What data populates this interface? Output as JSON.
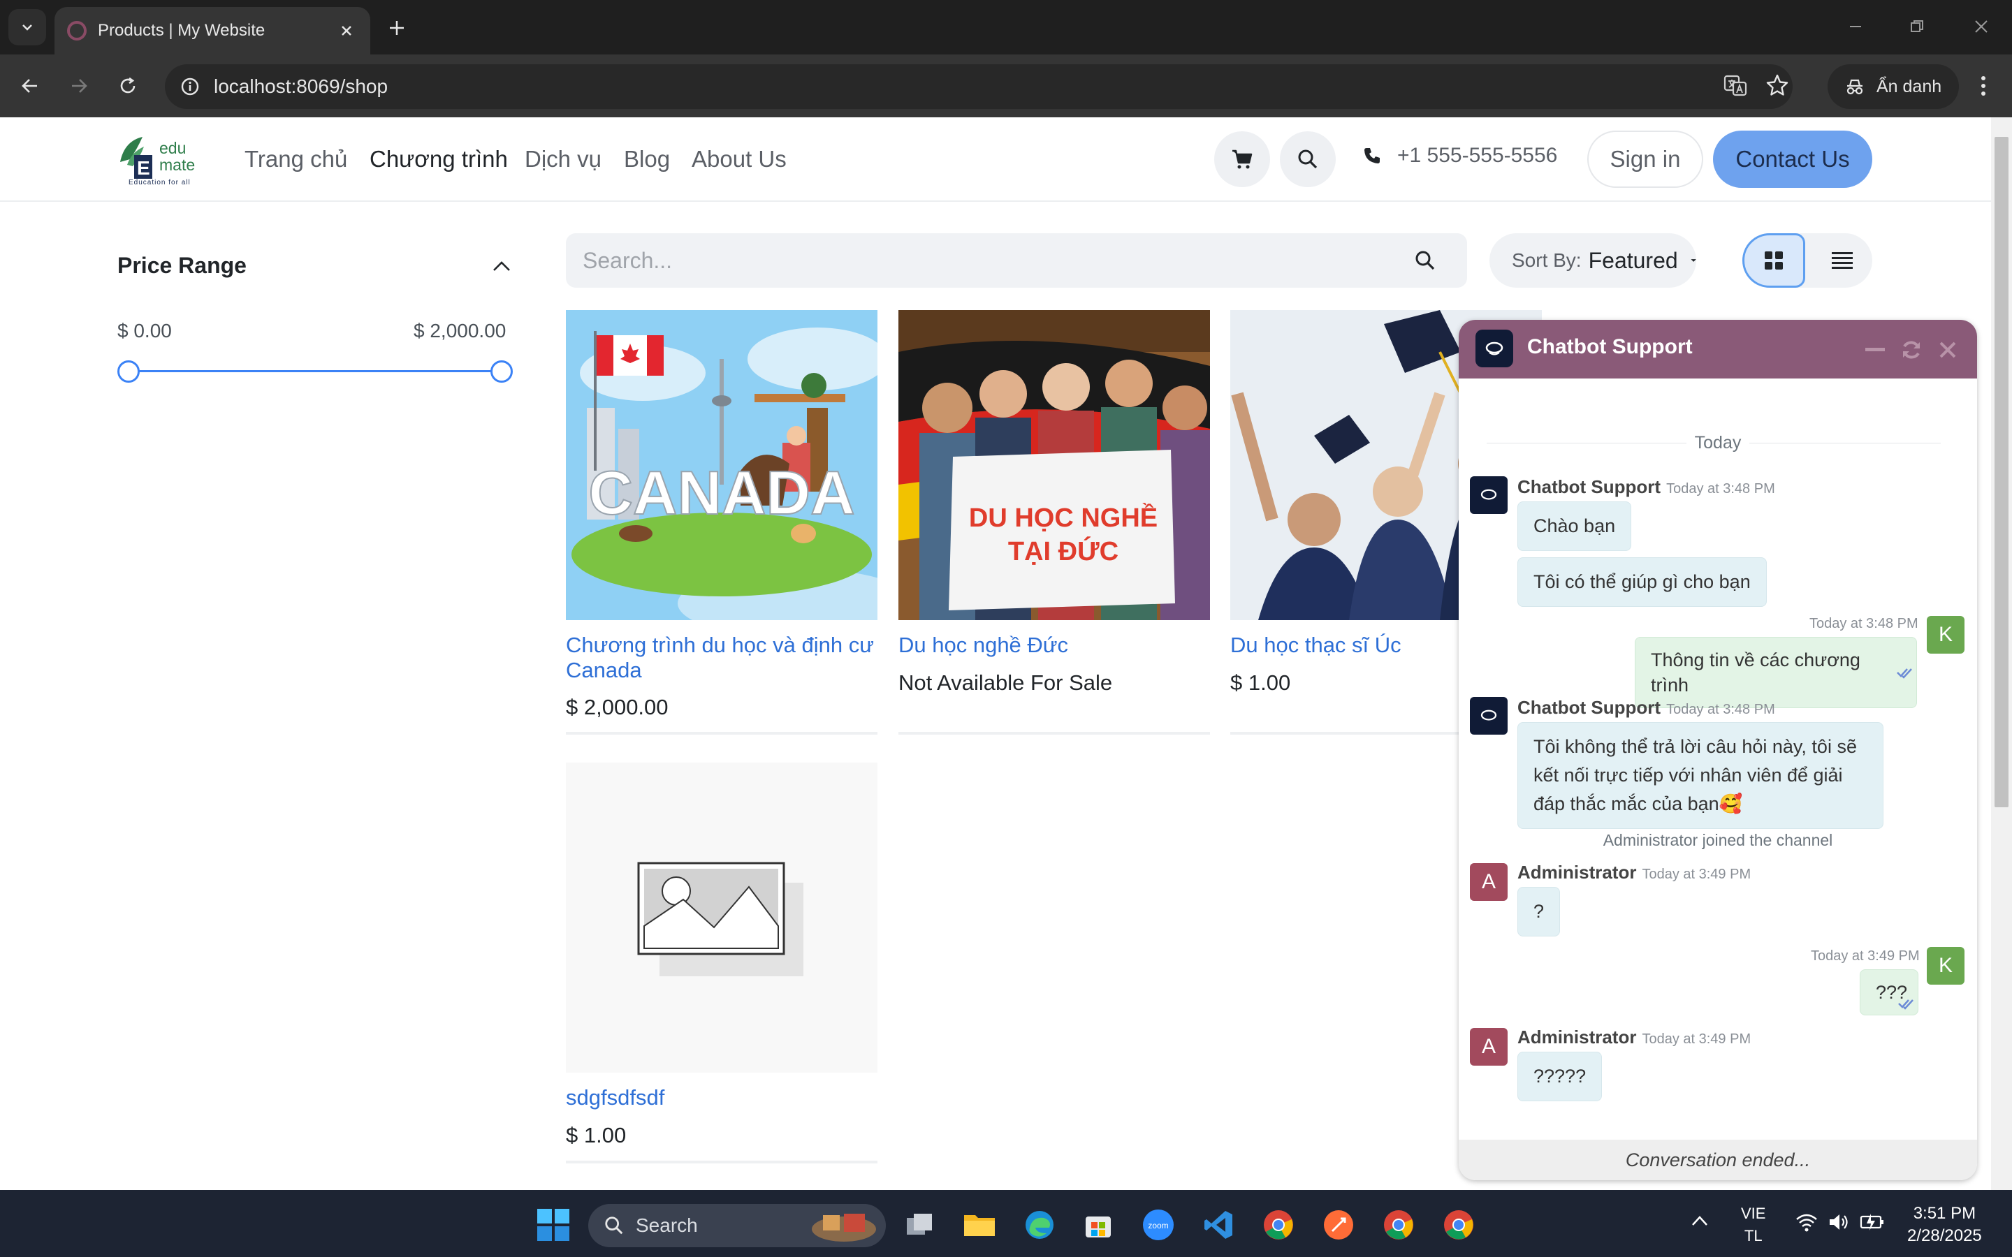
{
  "browser": {
    "tab_title": "Products | My Website",
    "url": "localhost:8069/shop",
    "incognito_label": "Ẩn danh"
  },
  "header": {
    "logo_top": "edu",
    "logo_bottom": "mate",
    "logo_tagline": "Education for all",
    "menu": [
      "Trang chủ",
      "Chương trình",
      "Dịch vụ",
      "Blog",
      "About Us"
    ],
    "active_menu": "Chương trình",
    "phone": "+1 555-555-5556",
    "signin_label": "Sign in",
    "contact_label": "Contact Us",
    "accent_color": "#6ea2ee"
  },
  "filter": {
    "title": "Price Range",
    "min": "$ 0.00",
    "max": "$ 2,000.00"
  },
  "search": {
    "placeholder": "Search...",
    "sort_label": "Sort By:",
    "sort_value": "Featured"
  },
  "products": [
    {
      "name": "Chương trình du học và định cư Canada",
      "price": "$ 2,000.00",
      "image_text": "CANADA"
    },
    {
      "name": "Du học nghề Đức",
      "price": "Not Available For Sale",
      "image_text_1": "DU HỌC NGHỀ",
      "image_text_2": "TẠI ĐỨC"
    },
    {
      "name": "Du học thạc sĩ Úc",
      "price": "$ 1.00"
    },
    {
      "name": "sdgfsdfsdf",
      "price": "$ 1.00"
    }
  ],
  "chat": {
    "title": "Chatbot Support",
    "day": "Today",
    "header_color": "#8a5a78",
    "messages": [
      {
        "author": "Chatbot Support",
        "time": "Today at 3:48 PM",
        "lines": [
          "Chào bạn",
          "Tôi có thể giúp gì cho bạn"
        ]
      },
      {
        "author": "K",
        "time": "Today at 3:48 PM",
        "text": "Thông tin về các chương trình"
      },
      {
        "author": "Chatbot Support",
        "time": "Today at 3:48 PM",
        "text": "Tôi không thể trả lời câu hỏi này, tôi sẽ kết nối trực tiếp với nhân viên để giải đáp thắc mắc của bạn🥰"
      },
      {
        "notice": "Administrator joined the channel"
      },
      {
        "author": "Administrator",
        "time": "Today at 3:49 PM",
        "text": "?"
      },
      {
        "author": "K",
        "time": "Today at 3:49 PM",
        "text": "???"
      },
      {
        "author": "Administrator",
        "time": "Today at 3:49 PM",
        "text": "?????"
      }
    ],
    "footer": "Conversation ended...",
    "avatar_bot_label": "ChatBot",
    "avatar_admin": "A",
    "avatar_user": "K"
  },
  "taskbar": {
    "search_label": "Search",
    "lang_1": "VIE",
    "lang_2": "TL",
    "time": "3:51 PM",
    "date": "2/28/2025",
    "zoom_label": "zoom"
  }
}
